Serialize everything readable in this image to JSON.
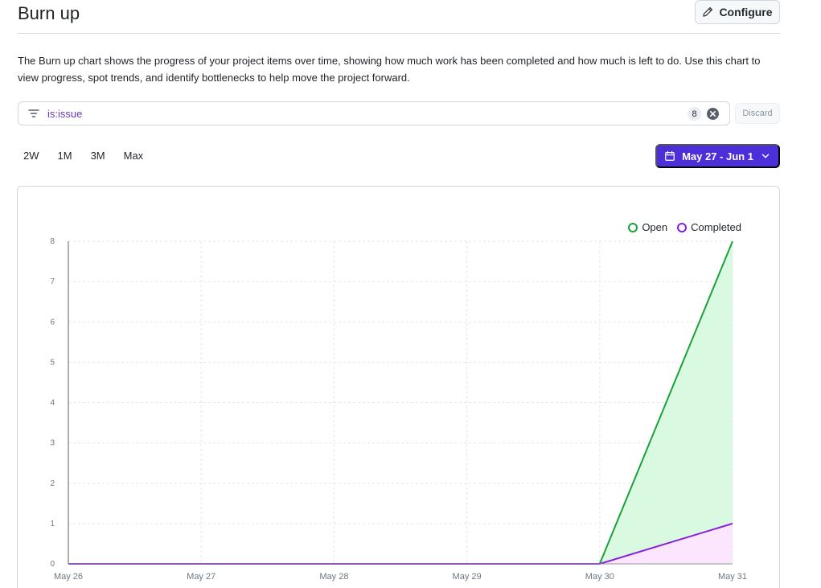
{
  "header": {
    "title": "Burn up",
    "configure_label": "Configure"
  },
  "description": "The Burn up chart shows the progress of your project items over time, showing how much work has been completed and how much is left to do. Use this chart to view progress, spot trends, and identify bottlenecks to help move the project forward.",
  "filter": {
    "query": "is:issue",
    "count": "8",
    "discard_label": "Discard"
  },
  "ranges": [
    "2W",
    "1M",
    "3M",
    "Max"
  ],
  "date_range": "May 27 - Jun 1",
  "colors": {
    "accent": "#4c2fd8",
    "open": "#1aa13b",
    "open_fill": "#d9fae0",
    "completed": "#8a1fd8",
    "completed_fill": "#fbe6fd"
  },
  "chart_data": {
    "type": "area",
    "x": [
      "May 26",
      "May 27",
      "May 28",
      "May 29",
      "May 30",
      "May 31"
    ],
    "y_ticks": [
      0,
      1,
      2,
      3,
      4,
      5,
      6,
      7,
      8
    ],
    "ylim": [
      0,
      8
    ],
    "grid": true,
    "legend_position": "top-right",
    "series": [
      {
        "name": "Open",
        "values": [
          0,
          0,
          0,
          0,
          0,
          8
        ]
      },
      {
        "name": "Completed",
        "values": [
          0,
          0,
          0,
          0,
          0,
          1
        ]
      }
    ]
  }
}
